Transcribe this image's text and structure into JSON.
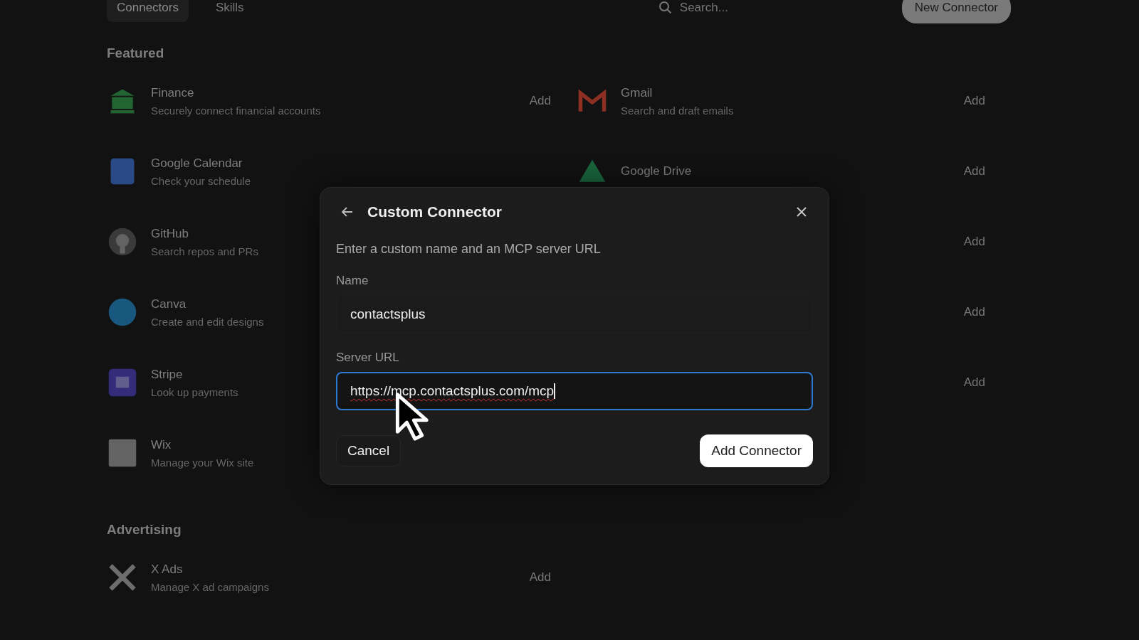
{
  "tabs": [
    {
      "label": "Connectors",
      "selected": true
    },
    {
      "label": "Skills",
      "selected": false
    }
  ],
  "search": {
    "placeholder": "Search..."
  },
  "new_button": "New Connector",
  "sections": [
    {
      "title": "Featured",
      "rows": [
        [
          {
            "name": "Finance",
            "description": "Securely connect financial accounts",
            "action": "Add",
            "kind": "bank"
          },
          {
            "name": "Gmail",
            "description": "Search and draft emails",
            "action": "Add",
            "kind": "mail"
          }
        ],
        [
          {
            "name": "Google Calendar",
            "description": "Check your schedule",
            "kind": "calendar"
          },
          {
            "name": "Google Drive",
            "action": "Add",
            "kind": "drive"
          }
        ],
        [
          {
            "name": "GitHub",
            "description": "Search repos and PRs",
            "kind": "github"
          },
          {
            "action": "Add"
          }
        ],
        [
          {
            "name": "Canva",
            "description": "Create and edit designs",
            "kind": "canva"
          },
          {
            "action": "Add"
          }
        ],
        [
          {
            "name": "Stripe",
            "description": "Look up payments",
            "kind": "stripe"
          },
          {
            "action": "Add"
          }
        ],
        [
          {
            "name": "Wix",
            "description": "Manage your Wix site",
            "kind": "wix"
          },
          {}
        ]
      ]
    },
    {
      "title": "Advertising",
      "rows": [
        [
          {
            "name": "X Ads",
            "description": "Manage X ad campaigns",
            "action": "Add",
            "kind": "x"
          },
          {}
        ]
      ]
    }
  ],
  "dialog": {
    "title": "Custom Connector",
    "subtitle": "Enter a custom name and an MCP server URL",
    "fields": [
      {
        "label": "Name",
        "value": "contactsplus",
        "focused": false,
        "misspelled": false
      },
      {
        "label": "Server URL",
        "value": "https://mcp.contactsplus.com/mcp",
        "focused": true,
        "misspelled": true
      }
    ],
    "cancel": "Cancel",
    "confirm": "Add Connector"
  }
}
